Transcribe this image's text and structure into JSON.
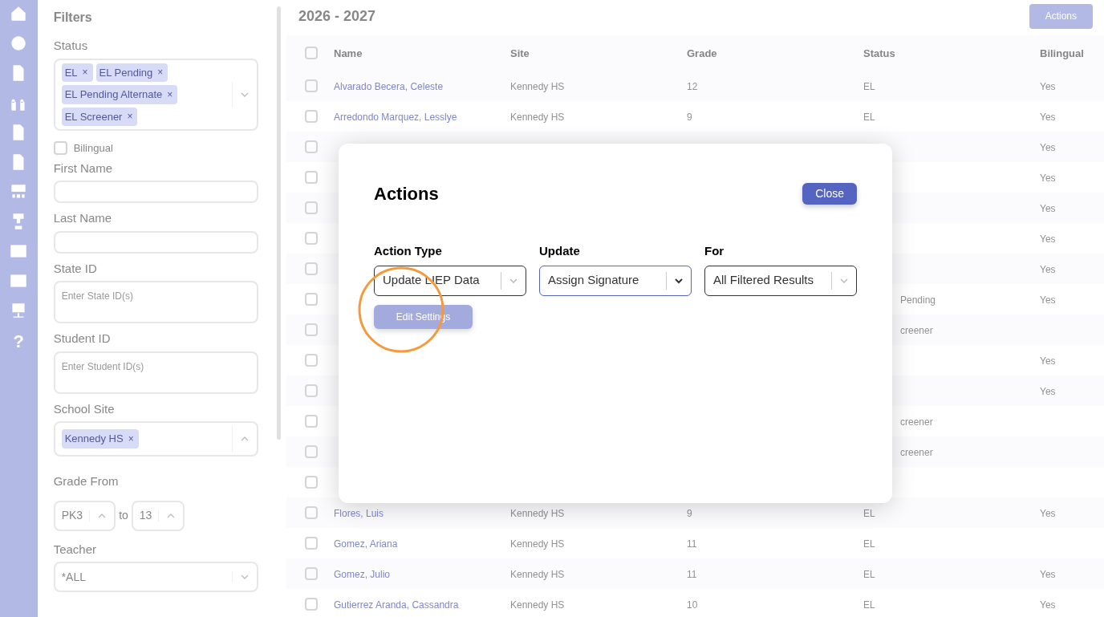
{
  "sidebar": {
    "help": "?"
  },
  "filters": {
    "title": "Filters",
    "fields": [
      {
        "kind": "chips",
        "label": "Status",
        "chips": [
          "EL",
          "EL Pending",
          "EL Pending Alternate",
          "EL Screener"
        ],
        "remove": "×",
        "expanded": false
      },
      {
        "kind": "checkbox",
        "label": "Bilingual",
        "checked": false
      },
      {
        "kind": "text",
        "label": "First Name"
      },
      {
        "kind": "text",
        "label": "Last Name"
      },
      {
        "kind": "textarea",
        "label": "State ID",
        "placeholder": "Enter State ID(s)"
      },
      {
        "kind": "textarea",
        "label": "Student ID",
        "placeholder": "Enter Student ID(s)"
      },
      {
        "kind": "chips",
        "label": "School Site",
        "chips": [
          "Kennedy HS"
        ],
        "remove": "×",
        "expanded": true
      },
      {
        "kind": "range",
        "label": "Grade From",
        "from": "PK3",
        "joiner": "to",
        "to": "13"
      },
      {
        "kind": "select",
        "label": "Teacher",
        "value": "*ALL"
      }
    ]
  },
  "header": {
    "title": "2026 - 2027",
    "actions_button": "Actions"
  },
  "table": {
    "select_all": {
      "checked": false
    },
    "columns": [
      "Name",
      "Site",
      "Grade",
      "Status",
      "Bilingual"
    ],
    "rows": [
      {
        "checked": false,
        "name": "Alvarado Becera, Celeste",
        "site": "Kennedy HS",
        "grade": "12",
        "status": "EL",
        "bilingual": "Yes"
      },
      {
        "checked": false,
        "name": "Arredondo Marquez, Lesslye",
        "site": "Kennedy HS",
        "grade": "9",
        "status": "EL",
        "bilingual": "Yes"
      },
      {
        "checked": false,
        "bilingual": "Yes"
      },
      {
        "checked": false,
        "bilingual": "Yes"
      },
      {
        "checked": false,
        "bilingual": "Yes"
      },
      {
        "checked": false,
        "bilingual": "Yes"
      },
      {
        "checked": false,
        "bilingual": "Yes"
      },
      {
        "checked": false,
        "status": "Pending",
        "bilingual": "Yes"
      },
      {
        "checked": false,
        "status": "creener"
      },
      {
        "checked": false,
        "bilingual": "Yes"
      },
      {
        "checked": false,
        "bilingual": "Yes"
      },
      {
        "checked": false,
        "status": "creener"
      },
      {
        "checked": false,
        "status": "creener"
      },
      {
        "checked": false
      },
      {
        "checked": false,
        "name": "Flores, Luis",
        "site": "Kennedy HS",
        "grade": "9",
        "status": "EL",
        "bilingual": "Yes"
      },
      {
        "checked": false,
        "name": "Gomez, Ariana",
        "site": "Kennedy HS",
        "grade": "11",
        "status": "EL"
      },
      {
        "checked": false,
        "name": "Gomez, Julio",
        "site": "Kennedy HS",
        "grade": "11",
        "status": "EL",
        "bilingual": "Yes"
      },
      {
        "checked": false,
        "name": "Gutierrez Aranda, Cassandra",
        "site": "Kennedy HS",
        "grade": "10",
        "status": "EL",
        "bilingual": "Yes"
      }
    ]
  },
  "dialog": {
    "title": "Actions",
    "close": "Close",
    "selects": [
      {
        "label": "Action Type",
        "value": "Update LIEP Data",
        "focused": false
      },
      {
        "label": "Update",
        "value": "Assign Signature",
        "focused": true
      },
      {
        "label": "For",
        "value": "All Filtered Results",
        "focused": false
      }
    ],
    "edit_button": "Edit Settings",
    "edit_disabled": true
  }
}
